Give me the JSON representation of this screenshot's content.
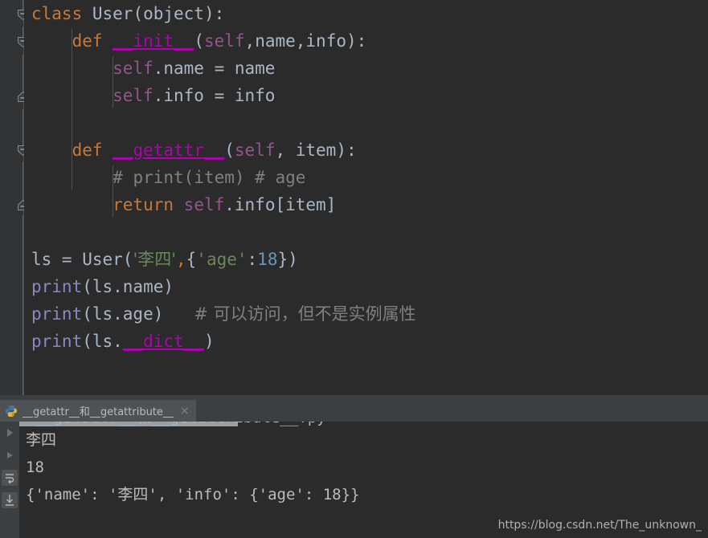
{
  "editor": {
    "background": "#2b2b2b",
    "gutter_background": "#313335",
    "lines": [
      {
        "n": 1,
        "segments": [
          {
            "t": "class ",
            "c": "kw"
          },
          {
            "t": "User",
            "c": "cls"
          },
          {
            "t": "(",
            "c": "pln"
          },
          {
            "t": "object",
            "c": "pln"
          },
          {
            "t": "):",
            "c": "pln"
          }
        ]
      },
      {
        "n": 2,
        "segments": [
          {
            "t": "    ",
            "c": "pln"
          },
          {
            "t": "def ",
            "c": "kw"
          },
          {
            "t": "__init__",
            "c": "dund"
          },
          {
            "t": "(",
            "c": "pln"
          },
          {
            "t": "self",
            "c": "self"
          },
          {
            "t": ",name,info):",
            "c": "pln"
          }
        ]
      },
      {
        "n": 3,
        "segments": [
          {
            "t": "        ",
            "c": "pln"
          },
          {
            "t": "self",
            "c": "self"
          },
          {
            "t": ".name = name",
            "c": "pln"
          }
        ]
      },
      {
        "n": 4,
        "segments": [
          {
            "t": "        ",
            "c": "pln"
          },
          {
            "t": "self",
            "c": "self"
          },
          {
            "t": ".info = info",
            "c": "pln"
          }
        ]
      },
      {
        "n": 5,
        "segments": []
      },
      {
        "n": 6,
        "segments": [
          {
            "t": "    ",
            "c": "pln"
          },
          {
            "t": "def ",
            "c": "kw"
          },
          {
            "t": "__getattr__",
            "c": "dund"
          },
          {
            "t": "(",
            "c": "pln"
          },
          {
            "t": "self",
            "c": "self"
          },
          {
            "t": ", item):",
            "c": "pln"
          }
        ]
      },
      {
        "n": 7,
        "segments": [
          {
            "t": "        ",
            "c": "pln"
          },
          {
            "t": "# print(item) # age",
            "c": "cmt"
          }
        ]
      },
      {
        "n": 8,
        "segments": [
          {
            "t": "        ",
            "c": "pln"
          },
          {
            "t": "return ",
            "c": "kw"
          },
          {
            "t": "self",
            "c": "self"
          },
          {
            "t": ".info[item]",
            "c": "pln"
          }
        ]
      },
      {
        "n": 9,
        "segments": []
      },
      {
        "n": 10,
        "segments": [
          {
            "t": "ls = User(",
            "c": "pln"
          },
          {
            "t": "'李四'",
            "c": "str cjk"
          },
          {
            "t": ",",
            "c": "kw"
          },
          {
            "t": "{",
            "c": "pln"
          },
          {
            "t": "'age'",
            "c": "str"
          },
          {
            "t": ":",
            "c": "pln"
          },
          {
            "t": "18",
            "c": "num"
          },
          {
            "t": "})",
            "c": "pln"
          }
        ]
      },
      {
        "n": 11,
        "segments": [
          {
            "t": "print",
            "c": "pfn"
          },
          {
            "t": "(ls.name)",
            "c": "pln"
          }
        ]
      },
      {
        "n": 12,
        "segments": [
          {
            "t": "print",
            "c": "pfn"
          },
          {
            "t": "(ls.age)   ",
            "c": "pln"
          },
          {
            "t": "# 可以访问，但不是实例属性",
            "c": "cmt cjk"
          }
        ]
      },
      {
        "n": 13,
        "segments": [
          {
            "t": "print",
            "c": "pfn"
          },
          {
            "t": "(ls.",
            "c": "pln"
          },
          {
            "t": "__dict__",
            "c": "dund"
          },
          {
            "t": ")",
            "c": "pln"
          }
        ]
      }
    ],
    "fold_markers": [
      {
        "line": 1,
        "type": "expanded-top"
      },
      {
        "line": 2,
        "type": "expanded-top"
      },
      {
        "line": 4,
        "type": "expanded-bottom"
      },
      {
        "line": 6,
        "type": "expanded-top"
      },
      {
        "line": 8,
        "type": "expanded-bottom"
      }
    ]
  },
  "run_tool_window": {
    "tab": {
      "icon": "python-icon",
      "label": "__getattr__和__getattribute__",
      "close": "×"
    },
    "console": {
      "lines": [
        "李四",
        "18",
        "{'name': '李四', 'info': {'age': 18}}"
      ]
    }
  },
  "watermark": {
    "text": "https://blog.csdn.net/The_unknown_"
  },
  "colors": {
    "keyword": "#cc7832",
    "string": "#6a8759",
    "number": "#6897bb",
    "comment": "#808080",
    "self": "#94558d",
    "dunder": "#b200b2",
    "print_fn": "#8888c6",
    "plain_text": "#a9b7c6",
    "editor_bg": "#2b2b2b",
    "panel_bg": "#3c3f41"
  }
}
